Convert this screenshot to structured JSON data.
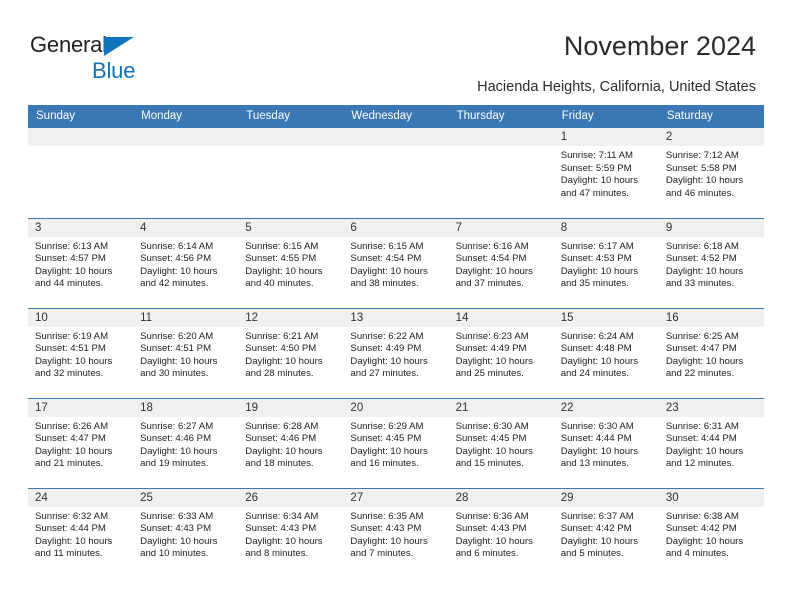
{
  "brand": {
    "name_part1": "General",
    "name_part2": "Blue",
    "triangle_color": "#1273bd"
  },
  "header": {
    "title": "November 2024",
    "subtitle": "Hacienda Heights, California, United States"
  },
  "theme": {
    "header_blue": "#3a78b5",
    "daynum_gray": "#f0f0f0",
    "text_color": "#222222"
  },
  "weekdays": [
    "Sunday",
    "Monday",
    "Tuesday",
    "Wednesday",
    "Thursday",
    "Friday",
    "Saturday"
  ],
  "weeks": [
    [
      {
        "day": "",
        "empty": true
      },
      {
        "day": "",
        "empty": true
      },
      {
        "day": "",
        "empty": true
      },
      {
        "day": "",
        "empty": true
      },
      {
        "day": "",
        "empty": true
      },
      {
        "day": "1",
        "sunrise": "Sunrise: 7:11 AM",
        "sunset": "Sunset: 5:59 PM",
        "daylight1": "Daylight: 10 hours",
        "daylight2": "and 47 minutes."
      },
      {
        "day": "2",
        "sunrise": "Sunrise: 7:12 AM",
        "sunset": "Sunset: 5:58 PM",
        "daylight1": "Daylight: 10 hours",
        "daylight2": "and 46 minutes."
      }
    ],
    [
      {
        "day": "3",
        "sunrise": "Sunrise: 6:13 AM",
        "sunset": "Sunset: 4:57 PM",
        "daylight1": "Daylight: 10 hours",
        "daylight2": "and 44 minutes."
      },
      {
        "day": "4",
        "sunrise": "Sunrise: 6:14 AM",
        "sunset": "Sunset: 4:56 PM",
        "daylight1": "Daylight: 10 hours",
        "daylight2": "and 42 minutes."
      },
      {
        "day": "5",
        "sunrise": "Sunrise: 6:15 AM",
        "sunset": "Sunset: 4:55 PM",
        "daylight1": "Daylight: 10 hours",
        "daylight2": "and 40 minutes."
      },
      {
        "day": "6",
        "sunrise": "Sunrise: 6:15 AM",
        "sunset": "Sunset: 4:54 PM",
        "daylight1": "Daylight: 10 hours",
        "daylight2": "and 38 minutes."
      },
      {
        "day": "7",
        "sunrise": "Sunrise: 6:16 AM",
        "sunset": "Sunset: 4:54 PM",
        "daylight1": "Daylight: 10 hours",
        "daylight2": "and 37 minutes."
      },
      {
        "day": "8",
        "sunrise": "Sunrise: 6:17 AM",
        "sunset": "Sunset: 4:53 PM",
        "daylight1": "Daylight: 10 hours",
        "daylight2": "and 35 minutes."
      },
      {
        "day": "9",
        "sunrise": "Sunrise: 6:18 AM",
        "sunset": "Sunset: 4:52 PM",
        "daylight1": "Daylight: 10 hours",
        "daylight2": "and 33 minutes."
      }
    ],
    [
      {
        "day": "10",
        "sunrise": "Sunrise: 6:19 AM",
        "sunset": "Sunset: 4:51 PM",
        "daylight1": "Daylight: 10 hours",
        "daylight2": "and 32 minutes."
      },
      {
        "day": "11",
        "sunrise": "Sunrise: 6:20 AM",
        "sunset": "Sunset: 4:51 PM",
        "daylight1": "Daylight: 10 hours",
        "daylight2": "and 30 minutes."
      },
      {
        "day": "12",
        "sunrise": "Sunrise: 6:21 AM",
        "sunset": "Sunset: 4:50 PM",
        "daylight1": "Daylight: 10 hours",
        "daylight2": "and 28 minutes."
      },
      {
        "day": "13",
        "sunrise": "Sunrise: 6:22 AM",
        "sunset": "Sunset: 4:49 PM",
        "daylight1": "Daylight: 10 hours",
        "daylight2": "and 27 minutes."
      },
      {
        "day": "14",
        "sunrise": "Sunrise: 6:23 AM",
        "sunset": "Sunset: 4:49 PM",
        "daylight1": "Daylight: 10 hours",
        "daylight2": "and 25 minutes."
      },
      {
        "day": "15",
        "sunrise": "Sunrise: 6:24 AM",
        "sunset": "Sunset: 4:48 PM",
        "daylight1": "Daylight: 10 hours",
        "daylight2": "and 24 minutes."
      },
      {
        "day": "16",
        "sunrise": "Sunrise: 6:25 AM",
        "sunset": "Sunset: 4:47 PM",
        "daylight1": "Daylight: 10 hours",
        "daylight2": "and 22 minutes."
      }
    ],
    [
      {
        "day": "17",
        "sunrise": "Sunrise: 6:26 AM",
        "sunset": "Sunset: 4:47 PM",
        "daylight1": "Daylight: 10 hours",
        "daylight2": "and 21 minutes."
      },
      {
        "day": "18",
        "sunrise": "Sunrise: 6:27 AM",
        "sunset": "Sunset: 4:46 PM",
        "daylight1": "Daylight: 10 hours",
        "daylight2": "and 19 minutes."
      },
      {
        "day": "19",
        "sunrise": "Sunrise: 6:28 AM",
        "sunset": "Sunset: 4:46 PM",
        "daylight1": "Daylight: 10 hours",
        "daylight2": "and 18 minutes."
      },
      {
        "day": "20",
        "sunrise": "Sunrise: 6:29 AM",
        "sunset": "Sunset: 4:45 PM",
        "daylight1": "Daylight: 10 hours",
        "daylight2": "and 16 minutes."
      },
      {
        "day": "21",
        "sunrise": "Sunrise: 6:30 AM",
        "sunset": "Sunset: 4:45 PM",
        "daylight1": "Daylight: 10 hours",
        "daylight2": "and 15 minutes."
      },
      {
        "day": "22",
        "sunrise": "Sunrise: 6:30 AM",
        "sunset": "Sunset: 4:44 PM",
        "daylight1": "Daylight: 10 hours",
        "daylight2": "and 13 minutes."
      },
      {
        "day": "23",
        "sunrise": "Sunrise: 6:31 AM",
        "sunset": "Sunset: 4:44 PM",
        "daylight1": "Daylight: 10 hours",
        "daylight2": "and 12 minutes."
      }
    ],
    [
      {
        "day": "24",
        "sunrise": "Sunrise: 6:32 AM",
        "sunset": "Sunset: 4:44 PM",
        "daylight1": "Daylight: 10 hours",
        "daylight2": "and 11 minutes."
      },
      {
        "day": "25",
        "sunrise": "Sunrise: 6:33 AM",
        "sunset": "Sunset: 4:43 PM",
        "daylight1": "Daylight: 10 hours",
        "daylight2": "and 10 minutes."
      },
      {
        "day": "26",
        "sunrise": "Sunrise: 6:34 AM",
        "sunset": "Sunset: 4:43 PM",
        "daylight1": "Daylight: 10 hours",
        "daylight2": "and 8 minutes."
      },
      {
        "day": "27",
        "sunrise": "Sunrise: 6:35 AM",
        "sunset": "Sunset: 4:43 PM",
        "daylight1": "Daylight: 10 hours",
        "daylight2": "and 7 minutes."
      },
      {
        "day": "28",
        "sunrise": "Sunrise: 6:36 AM",
        "sunset": "Sunset: 4:43 PM",
        "daylight1": "Daylight: 10 hours",
        "daylight2": "and 6 minutes."
      },
      {
        "day": "29",
        "sunrise": "Sunrise: 6:37 AM",
        "sunset": "Sunset: 4:42 PM",
        "daylight1": "Daylight: 10 hours",
        "daylight2": "and 5 minutes."
      },
      {
        "day": "30",
        "sunrise": "Sunrise: 6:38 AM",
        "sunset": "Sunset: 4:42 PM",
        "daylight1": "Daylight: 10 hours",
        "daylight2": "and 4 minutes."
      }
    ]
  ]
}
